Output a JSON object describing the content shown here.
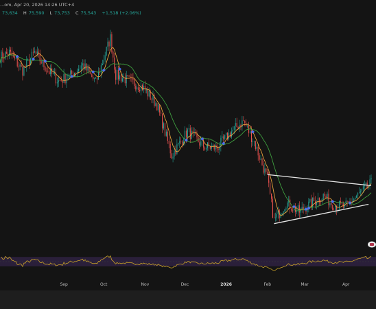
{
  "header": {
    "title": "...om, Apr 20, 2026 14:26 UTC+4",
    "quote": [
      {
        "label": "",
        "value": "73,634"
      },
      {
        "label": "H",
        "value": "75,590"
      },
      {
        "label": "L",
        "value": "73,753"
      },
      {
        "label": "C",
        "value": "75,543"
      },
      {
        "label": "",
        "value": "+1,518 (+2.06%)"
      }
    ]
  },
  "colors": {
    "background": "#141414",
    "up": "#26a69a",
    "down": "#ef5350",
    "ma_fast": "#e8a33d",
    "ma_slow": "#3f9f3f",
    "signal": "#4c6ff0",
    "oscillator": "#c9a227",
    "oscillator_band": "#2a1f3a",
    "trendline": "#e6e6e6"
  },
  "x_axis": {
    "labels": [
      "Sep",
      "Oct",
      "Nov",
      "Dec",
      "2026",
      "Feb",
      "Mar",
      "Apr"
    ],
    "bold": [
      "2026"
    ]
  },
  "chart_data": {
    "type": "candlestick",
    "x_range": [
      "2025-07-15",
      "2026-04-20"
    ],
    "ohlc_keypoints": [
      {
        "date": "2025-07-15",
        "close": 118000
      },
      {
        "date": "2025-07-22",
        "close": 119500
      },
      {
        "date": "2025-08-01",
        "close": 113500
      },
      {
        "date": "2025-08-10",
        "close": 119500
      },
      {
        "date": "2025-08-20",
        "close": 113500
      },
      {
        "date": "2025-08-28",
        "close": 110000
      },
      {
        "date": "2025-09-05",
        "close": 111500
      },
      {
        "date": "2025-09-15",
        "close": 115500
      },
      {
        "date": "2025-09-25",
        "close": 109500
      },
      {
        "date": "2025-10-06",
        "close": 124500
      },
      {
        "date": "2025-10-10",
        "close": 112000
      },
      {
        "date": "2025-10-20",
        "close": 110000
      },
      {
        "date": "2025-10-30",
        "close": 108000
      },
      {
        "date": "2025-11-10",
        "close": 102000
      },
      {
        "date": "2025-11-21",
        "close": 85000
      },
      {
        "date": "2025-12-03",
        "close": 93000
      },
      {
        "date": "2025-12-15",
        "close": 88000
      },
      {
        "date": "2025-12-25",
        "close": 87500
      },
      {
        "date": "2026-01-05",
        "close": 93000
      },
      {
        "date": "2026-01-14",
        "close": 96500
      },
      {
        "date": "2026-01-22",
        "close": 89500
      },
      {
        "date": "2026-02-01",
        "close": 77000
      },
      {
        "date": "2026-02-06",
        "close": 63000
      },
      {
        "date": "2026-02-15",
        "close": 69000
      },
      {
        "date": "2026-02-25",
        "close": 66000
      },
      {
        "date": "2026-03-08",
        "close": 69500
      },
      {
        "date": "2026-03-15",
        "close": 71500
      },
      {
        "date": "2026-03-22",
        "close": 68500
      },
      {
        "date": "2026-03-31",
        "close": 67500
      },
      {
        "date": "2026-04-10",
        "close": 71500
      },
      {
        "date": "2026-04-20",
        "close": 75543
      }
    ],
    "trendlines": [
      {
        "name": "upper",
        "from": {
          "date": "2026-02-01",
          "price": 78500
        },
        "to": {
          "date": "2026-04-20",
          "price": 74800
        }
      },
      {
        "name": "lower",
        "from": {
          "date": "2026-02-06",
          "price": 62000
        },
        "to": {
          "date": "2026-04-18",
          "price": 68500
        }
      }
    ],
    "moving_averages": [
      "fast",
      "slow"
    ],
    "oscillator": {
      "type": "line",
      "range": [
        0,
        100
      ],
      "band": [
        30,
        70
      ]
    },
    "grid": false
  }
}
